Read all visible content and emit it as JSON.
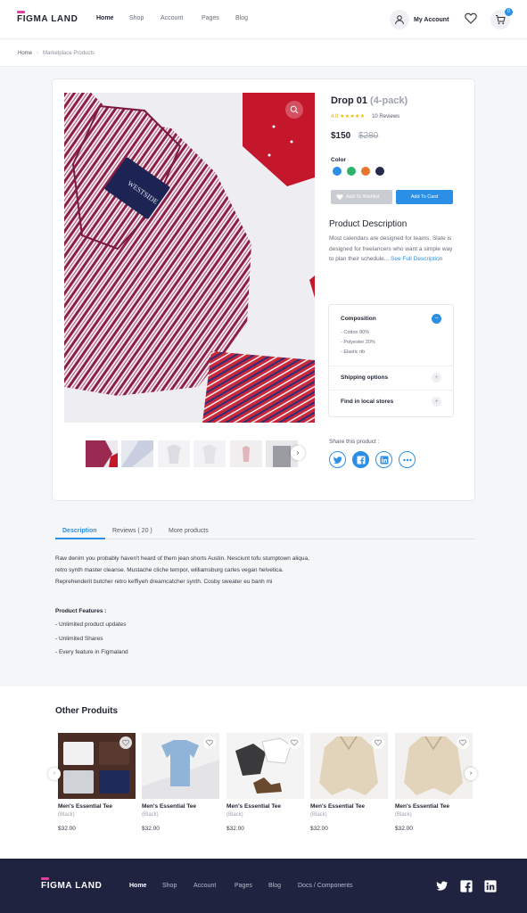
{
  "brand": {
    "logo_text": "FIGMA LAND"
  },
  "header": {
    "nav": [
      "Home",
      "Shop",
      "Account",
      "Pages",
      "Blog"
    ],
    "account_label": "My Account",
    "cart_count": "0"
  },
  "breadcrumb": {
    "home": "Home",
    "current": "Marketplace Products"
  },
  "product": {
    "title": "Drop 01",
    "pack": "(4-pack)",
    "rating": "4.0",
    "stars": "★★★★★",
    "reviews": "10 Reviews",
    "price": "$150",
    "old_price": "$280",
    "color_label": "Color",
    "colors": [
      "#2b8fe6",
      "#2fb36b",
      "#e8772e",
      "#262a4d"
    ],
    "wishlist_label": "Add To Wishlist",
    "cart_label": "Add To Card",
    "description_heading": "Product Description",
    "description": "Most calendars are designed for teams. Slate is designed for freelancers who want a simple way to plan their schedule...",
    "see_more": "See Full Description",
    "accordion": {
      "composition": "Composition",
      "composition_items": [
        "- Cotton 80%",
        "- Polyester 20%",
        "- Elastic rib"
      ],
      "shipping": "Shipping options",
      "stores": "Find in local stores"
    },
    "share_label": "Share this product :"
  },
  "tabs": [
    "Description",
    "Reviews ( 20 )",
    "More products"
  ],
  "details": {
    "text": "Raw denim you probably haven't heard of them jean shorts Austin. Nesciunt tofu stumptown aliqua, retro synth master cleanse. Mustache cliche tempor, williamsburg carles vegan helvetica. Reprehenderit butcher retro keffiyeh dreamcatcher synth. Cosby sweater eu banh mi",
    "features_heading": "Product Features :",
    "features": [
      "- Unlimited product updates",
      "- Unlimited Shares",
      "- Every feature in Figmaland"
    ]
  },
  "other": {
    "heading": "Other Produits",
    "products": [
      {
        "name": "Men's Essential Tee",
        "variant": "(Black)",
        "price": "$32.00"
      },
      {
        "name": "Men's Essential Tee",
        "variant": "(Black)",
        "price": "$32.00"
      },
      {
        "name": "Men's Essential Tee",
        "variant": "(Black)",
        "price": "$32.00"
      },
      {
        "name": "Men's Essential Tee",
        "variant": "(Black)",
        "price": "$32.00"
      },
      {
        "name": "Men's Essential Tee",
        "variant": "(Black)",
        "price": "$32.00"
      }
    ]
  },
  "footer": {
    "nav": [
      "Home",
      "Shop",
      "Account",
      "Pages",
      "Blog",
      "Docs / Components"
    ]
  },
  "icons": {
    "account": "user-icon",
    "wishlist": "heart-icon",
    "cart": "cart-icon",
    "zoom": "search-icon",
    "share": [
      "twitter-icon",
      "facebook-icon",
      "linkedin-icon",
      "more-icon"
    ]
  },
  "accent_color": "#2b8fe6"
}
